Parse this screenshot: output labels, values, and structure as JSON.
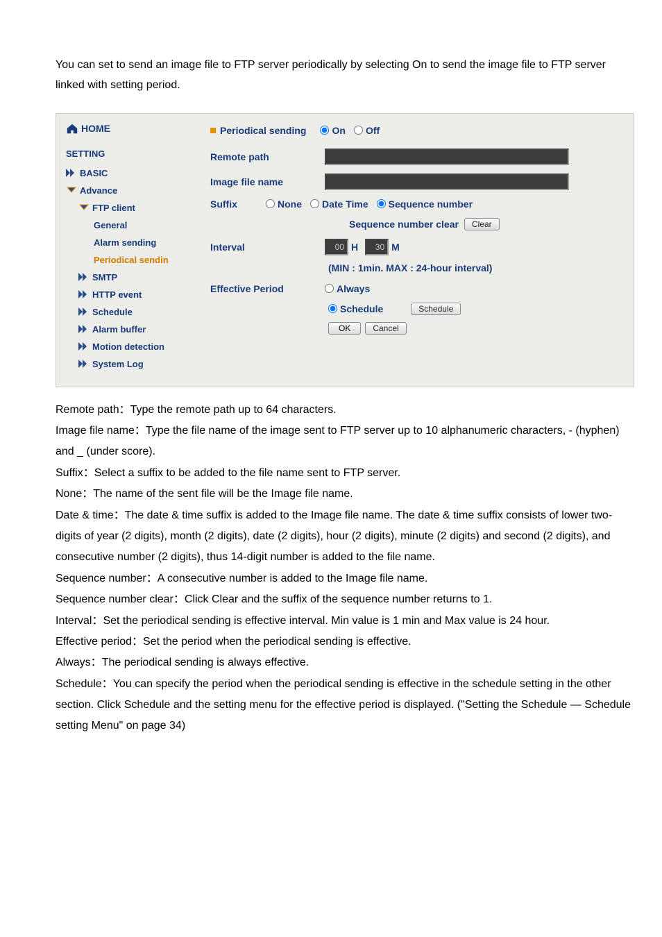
{
  "intro": "You can set to send an image file to FTP server periodically by selecting On to send the image file to FTP server linked with setting period.",
  "sidebar": {
    "home": "HOME",
    "setting": "SETTING",
    "basic": "BASIC",
    "advance": "Advance",
    "ftp_client": "FTP client",
    "general": "General",
    "alarm_sending": "Alarm sending",
    "periodical_sendin": "Periodical sendin",
    "smtp": "SMTP",
    "http_event": "HTTP event",
    "schedule": "Schedule",
    "alarm_buffer": "Alarm buffer",
    "motion_detection": "Motion detection",
    "system_log": "System Log"
  },
  "form": {
    "periodical_sending": "Periodical sending",
    "on": "On",
    "off": "Off",
    "remote_path": "Remote path",
    "image_file_name": "Image file name",
    "suffix": "Suffix",
    "none": "None",
    "date_time": "Date Time",
    "sequence_number": "Sequence number",
    "sequence_number_clear": "Sequence number clear",
    "clear_btn": "Clear",
    "interval": "Interval",
    "interval_h": "00",
    "interval_m": "30",
    "h_unit": "H",
    "m_unit": "M",
    "interval_hint": "(MIN : 1min. MAX : 24-hour interval)",
    "effective_period": "Effective Period",
    "always": "Always",
    "schedule": "Schedule",
    "schedule_btn": "Schedule",
    "ok": "OK",
    "cancel": "Cancel"
  },
  "desc": {
    "l1": "Remote path：Type the remote path up to 64 characters.",
    "l2": "Image file name：Type the file name of the image sent to FTP server up to 10 alphanumeric characters, - (hyphen) and _ (under score).",
    "l3": "Suffix：Select a suffix to be added to the file name sent to FTP server.",
    "l4": "None：The name of the sent file will be the Image file name.",
    "l5": "Date & time：The date & time suffix is added to the Image file name. The date & time suffix consists of lower two-digits of year (2 digits), month (2 digits), date (2 digits), hour (2 digits), minute (2 digits) and second (2 digits), and consecutive number (2 digits), thus 14-digit number is added to the file name.",
    "l6": "Sequence number：A consecutive number is added to the Image file name.",
    "l7": "Sequence number clear：Click Clear and the suffix of the sequence number returns to 1.",
    "l8": "Interval：Set the periodical sending is effective interval. Min value is 1 min and Max value is 24 hour.",
    "l9": "Effective period：Set the period when the periodical sending is effective.",
    "l10": "Always：The periodical sending is always effective.",
    "l11": "Schedule：You can specify the period when the periodical sending is effective in the schedule setting in the other section. Click Schedule and the setting menu for the effective period is displayed. (\"Setting the Schedule — Schedule setting Menu\" on page 34)"
  }
}
